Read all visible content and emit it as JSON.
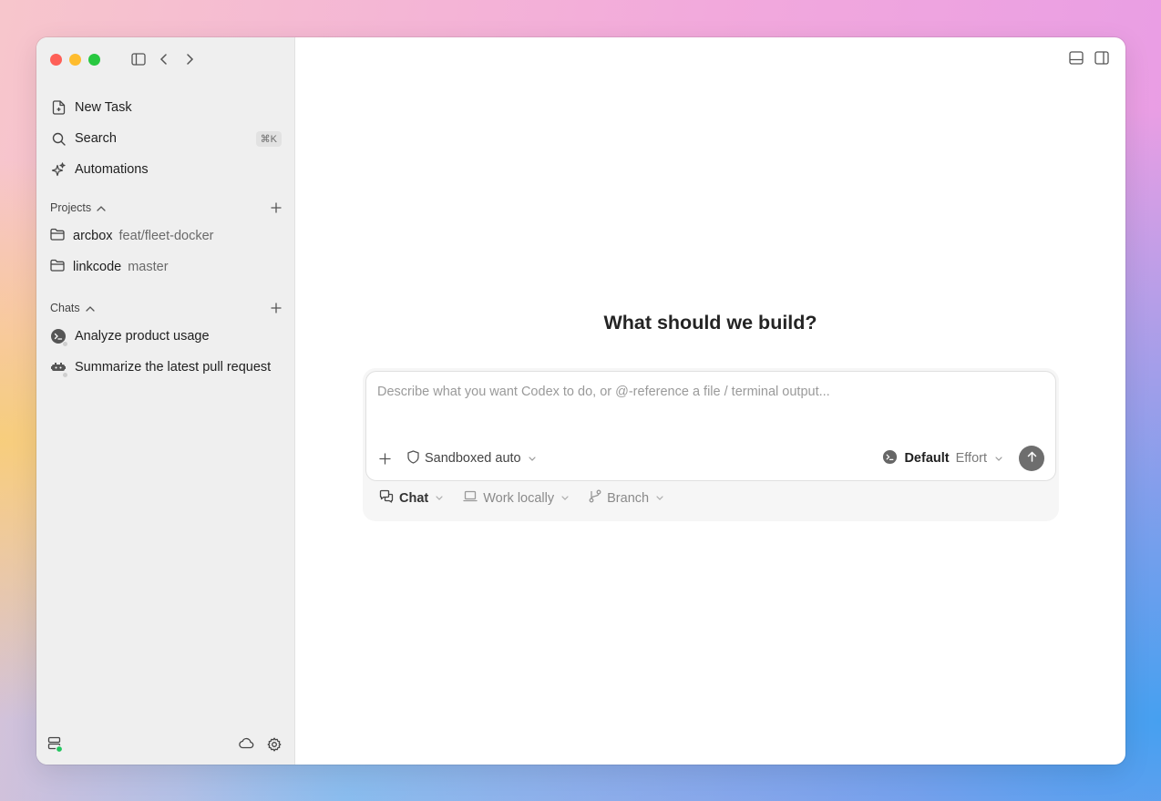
{
  "sidebar": {
    "nav": [
      {
        "label": "New Task",
        "icon": "new-task-icon"
      },
      {
        "label": "Search",
        "icon": "search-icon",
        "shortcut": "⌘K"
      },
      {
        "label": "Automations",
        "icon": "sparkle-icon"
      }
    ],
    "projects": {
      "title": "Projects",
      "items": [
        {
          "name": "arcbox",
          "branch": "feat/fleet-docker"
        },
        {
          "name": "linkcode",
          "branch": "master"
        }
      ]
    },
    "chats": {
      "title": "Chats",
      "items": [
        {
          "label": "Analyze product usage"
        },
        {
          "label": "Summarize the latest pull request"
        }
      ]
    }
  },
  "main": {
    "heading": "What should we build?",
    "composer": {
      "placeholder": "Describe what you want Codex to do, or @-reference a file / terminal output...",
      "sandbox_label": "Sandboxed auto",
      "model_label": "Default",
      "effort_label": "Effort"
    },
    "options": {
      "chat_label": "Chat",
      "work_label": "Work locally",
      "branch_label": "Branch"
    }
  },
  "colors": {
    "close": "#fe5f57",
    "minimize": "#febc2e",
    "zoom": "#28c840",
    "status": "#22c55e",
    "send": "#6e6e6e"
  }
}
